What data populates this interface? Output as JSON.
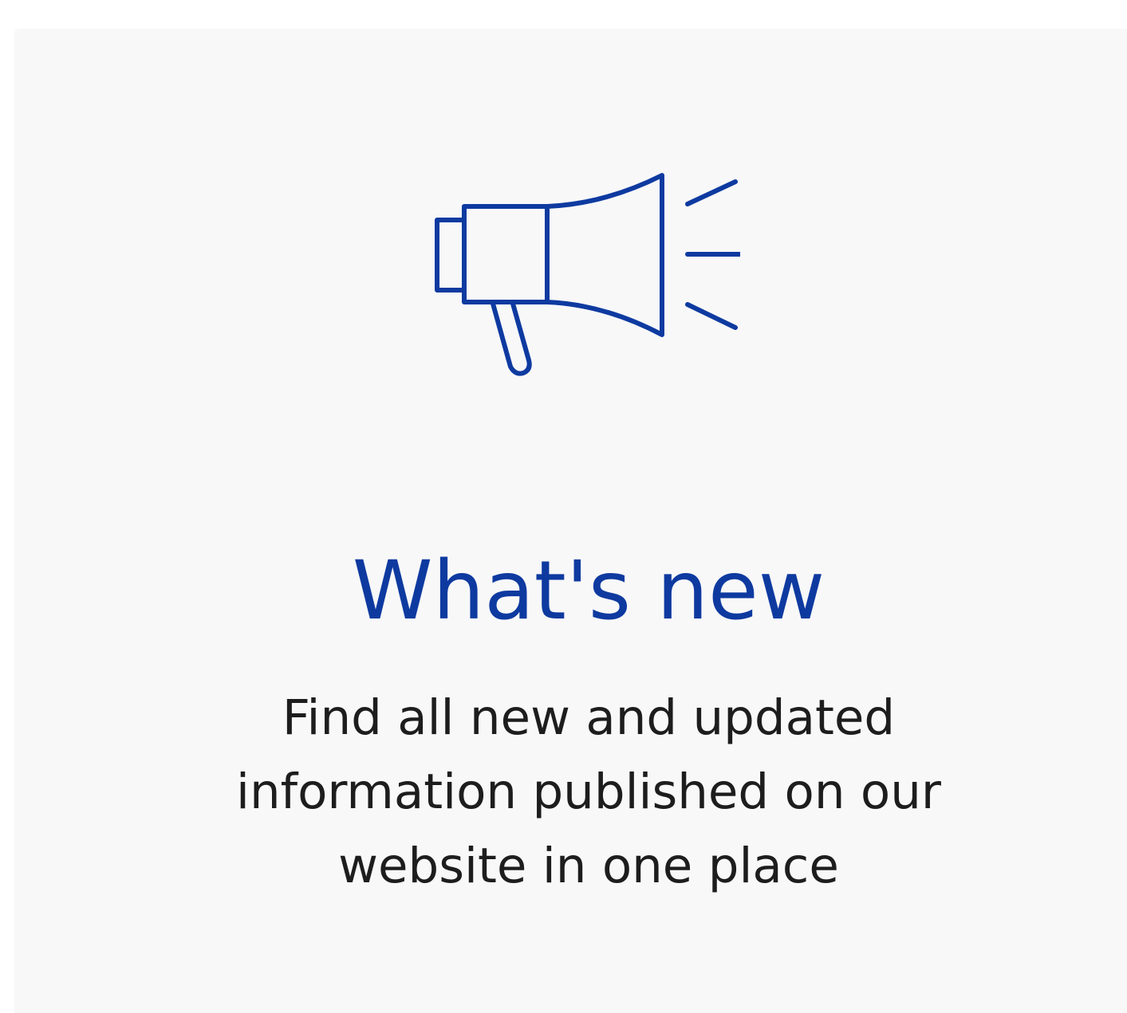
{
  "card": {
    "icon": "megaphone-icon",
    "title": "What's new",
    "description": "Find all new and updated information published on our website in one place"
  },
  "colors": {
    "accent": "#0e3aa0",
    "background": "#f8f8f9",
    "text": "#1d1d1d"
  }
}
